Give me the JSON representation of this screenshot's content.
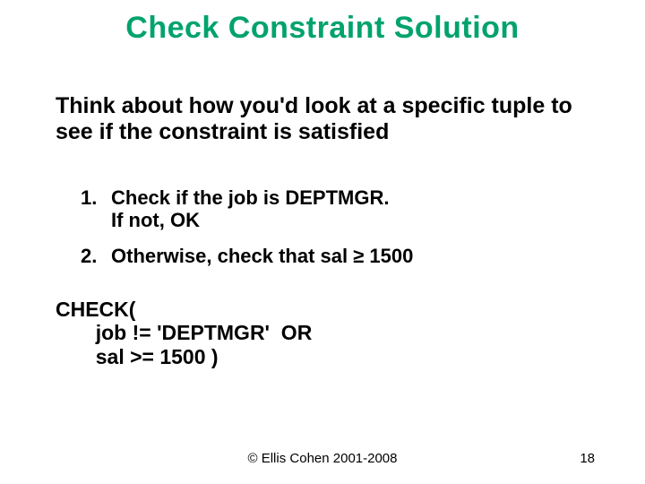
{
  "title": "Check Constraint Solution",
  "intro": "Think about how you'd look at a specific tuple to see if the constraint is satisfied",
  "items": [
    {
      "num": "1.",
      "text": "Check if the job is DEPTMGR.\nIf not, OK"
    },
    {
      "num": "2.",
      "text": "Otherwise, check that sal ≥ 1500"
    }
  ],
  "check_code": "CHECK(\n       job != 'DEPTMGR'  OR\n       sal >= 1500 )",
  "copyright": "© Ellis Cohen 2001-2008",
  "page_number": "18"
}
